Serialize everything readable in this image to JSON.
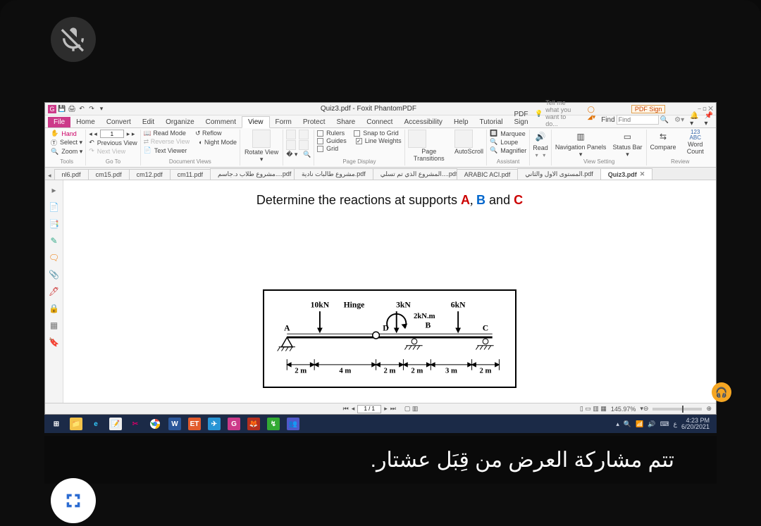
{
  "meeting": {
    "share_msg": "تتم مشاركة العرض من قِبَل عشتار."
  },
  "titlebar": {
    "title": "Quiz3.pdf - Foxit PhantomPDF",
    "pdf_sign": "PDF Sign",
    "window_controls": "⎯  ◻  ✕"
  },
  "ribbon": {
    "tabs": {
      "file": "File",
      "home": "Home",
      "convert": "Convert",
      "edit": "Edit",
      "organize": "Organize",
      "comment": "Comment",
      "view": "View",
      "form": "Form",
      "protect": "Protect",
      "share": "Share",
      "connect": "Connect",
      "accessibility": "Accessibility",
      "help": "Help",
      "tutorial": "Tutorial",
      "pdf_sign": "PDF Sign"
    },
    "tellme_placeholder": "Tell me what you want to do...",
    "find_label": "Find",
    "groups": {
      "tools": {
        "hand": "Hand",
        "select": "Select ▾",
        "zoom": "Zoom ▾",
        "label": "Tools"
      },
      "goto": {
        "prev": "Previous View",
        "next": "Next View",
        "page": "1",
        "label": "Go To"
      },
      "docviews": {
        "read": "Read Mode",
        "reflow": "Reflow",
        "reverse": "Reverse View",
        "night": "Night Mode",
        "textviewer": "Text Viewer",
        "label": "Document Views"
      },
      "pageview": {
        "rotate": "Rotate\nView ▾",
        "label": ""
      },
      "pagedisplay": {
        "rulers": "Rulers",
        "snap": "Snap to Grid",
        "guides": "Guides",
        "linew": "Line Weights",
        "grid": "Grid",
        "label": "Page Display"
      },
      "trans": {
        "page": "Page\nTransitions",
        "auto": "AutoScroll",
        "label": ""
      },
      "assistant": {
        "marquee": "Marquee",
        "loupe": "Loupe",
        "magnifier": "Magnifier",
        "read": "Read",
        "label": "Assistant"
      },
      "viewsetting": {
        "nav": "Navigation\nPanels ▾",
        "status": "Status\nBar ▾",
        "label": "View Setting"
      },
      "review": {
        "compare": "Compare",
        "word": "Word\nCount",
        "abc": "ABC",
        "num": "123",
        "label": "Review"
      }
    }
  },
  "doc_tabs": [
    "nl6.pdf",
    "cm15.pdf",
    "cm12.pdf",
    "cm11.pdf",
    "مشروع طلاب د.جاسم....pdf",
    "مشروع طالبات نادية.pdf",
    "المشروع الذي تم تسلي....pdf",
    "ARABIC ACI.pdf",
    "المستوى الاول والثاني.pdf",
    "Quiz3.pdf"
  ],
  "problem": {
    "prompt_pre": "Determine the reactions at supports ",
    "a": "A",
    "b": "B",
    "c": "C",
    "and": " and ",
    "loads": {
      "ten": "10kN",
      "hinge": "Hinge",
      "three": "3kN",
      "moment": "2kN.m",
      "six": "6kN"
    },
    "points": {
      "A": "A",
      "D": "D",
      "B": "B",
      "C": "C"
    },
    "dims": {
      "d1": "2 m",
      "d2": "4 m",
      "d3": "2 m",
      "d4": "2 m",
      "d5": "3 m",
      "d6": "2 m"
    }
  },
  "statusbar": {
    "page": "1 / 1",
    "zoom": "145.97%"
  },
  "taskbar": {
    "items": [
      "start",
      "files",
      "ie",
      "notes",
      "snip",
      "chrome",
      "word",
      "et",
      "telegram",
      "g",
      "foxit",
      "xr",
      "teams"
    ],
    "time": "4:23 PM",
    "date": "6/20/2021",
    "lang": "ع"
  }
}
